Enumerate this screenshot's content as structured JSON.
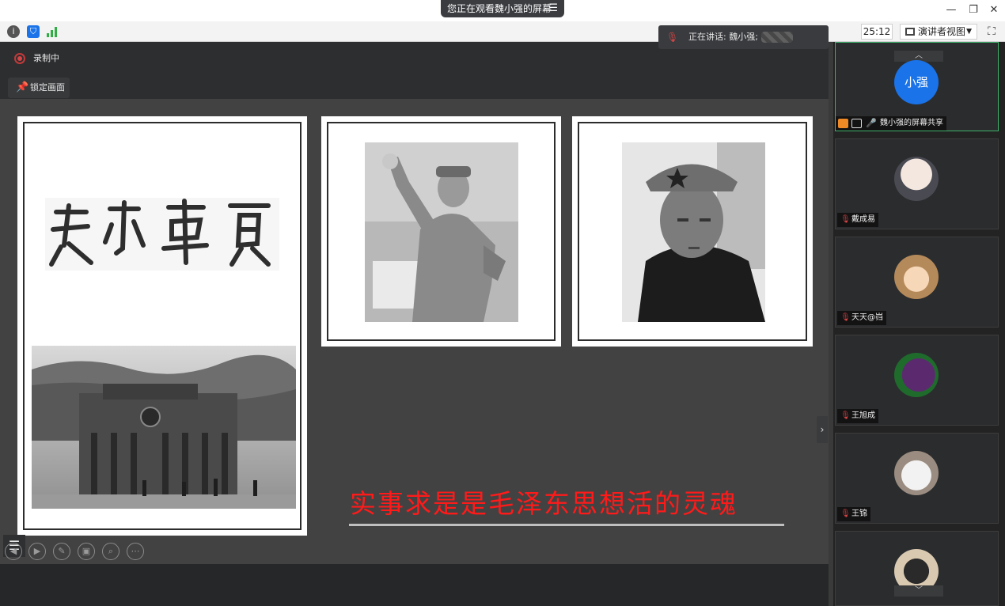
{
  "window": {
    "share_title": "您正在观看魏小强的屏幕",
    "menu_icon": "hamburger-icon",
    "controls": [
      "minimize-icon",
      "restore-icon",
      "close-icon"
    ]
  },
  "toolbar": {
    "timer": "25:12",
    "view_label": "演讲者视图",
    "icons": [
      "info-icon",
      "shield-icon",
      "signal-icon",
      "fullscreen-icon"
    ]
  },
  "stage": {
    "recording_label": "录制中",
    "lock_label": "锁定画面"
  },
  "speaking": {
    "label": "正在讲话: 魏小强;"
  },
  "slide": {
    "calligraphy_alt": "实事求是 calligraphy",
    "caption": "实事求是是毛泽东思想活的灵魂"
  },
  "participants": [
    {
      "name": "魏小强的屏幕共享",
      "avatar_text": "小强",
      "active": true
    },
    {
      "name": "戴成易"
    },
    {
      "name": "天天@岿"
    },
    {
      "name": "王旭成"
    },
    {
      "name": "王锦"
    },
    {
      "name": ""
    }
  ],
  "colors": {
    "accent": "#1a73e8",
    "caption_red": "#ff1a1a",
    "recording_red": "#d64545",
    "active_border": "#3fb26b"
  }
}
